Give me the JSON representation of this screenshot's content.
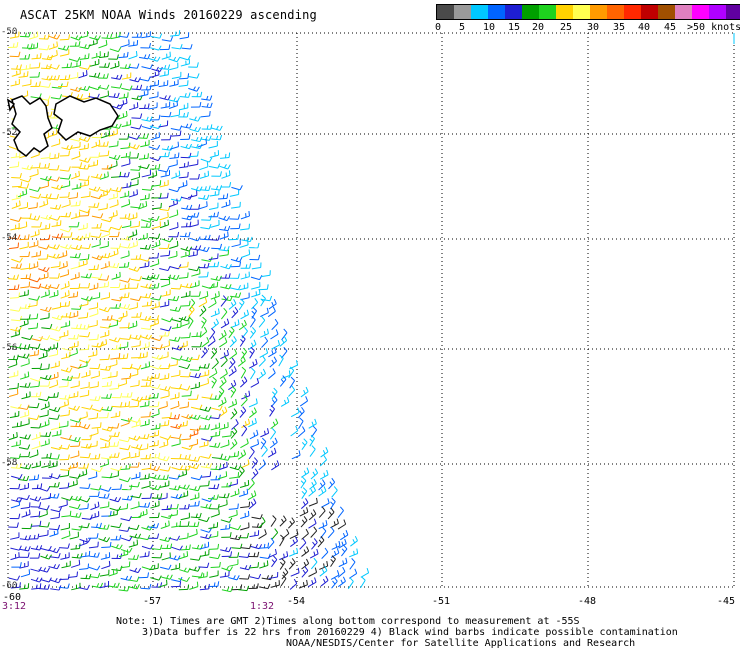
{
  "title": "ASCAT 25KM NOAA Winds 20160229 ascending",
  "legend": {
    "unit_label": ">50 knots",
    "ticks": [
      "0",
      "5",
      "10",
      "15",
      "20",
      "25",
      "30",
      "35",
      "40",
      "45"
    ],
    "colors": [
      "#4a4a4a",
      "#9a9a9a",
      "#00c8ff",
      "#0064ff",
      "#1e1ed2",
      "#00a000",
      "#1ed21e",
      "#ffd200",
      "#ffff50",
      "#ff9b00",
      "#ff6400",
      "#ff2800",
      "#c00000",
      "#a05000",
      "#e080c0",
      "#ff00ff",
      "#b000ff",
      "#6000a0"
    ]
  },
  "axes": {
    "longitudes": [
      "-60",
      "-57",
      "-54",
      "-51",
      "-48",
      "-45"
    ],
    "latitudes": [
      "-50",
      "-52",
      "-54",
      "-56",
      "-58",
      "-60"
    ]
  },
  "times": [
    "3:12",
    "1:32"
  ],
  "notes": [
    "Note: 1) Times are GMT 2)Times along bottom correspond to measurement at -55S",
    "3)Data buffer is 22 hrs from 20160229 4) Black wind barbs indicate possible contamination",
    "NOAA/NESDIS/Center for Satellite Applications and Research"
  ]
}
